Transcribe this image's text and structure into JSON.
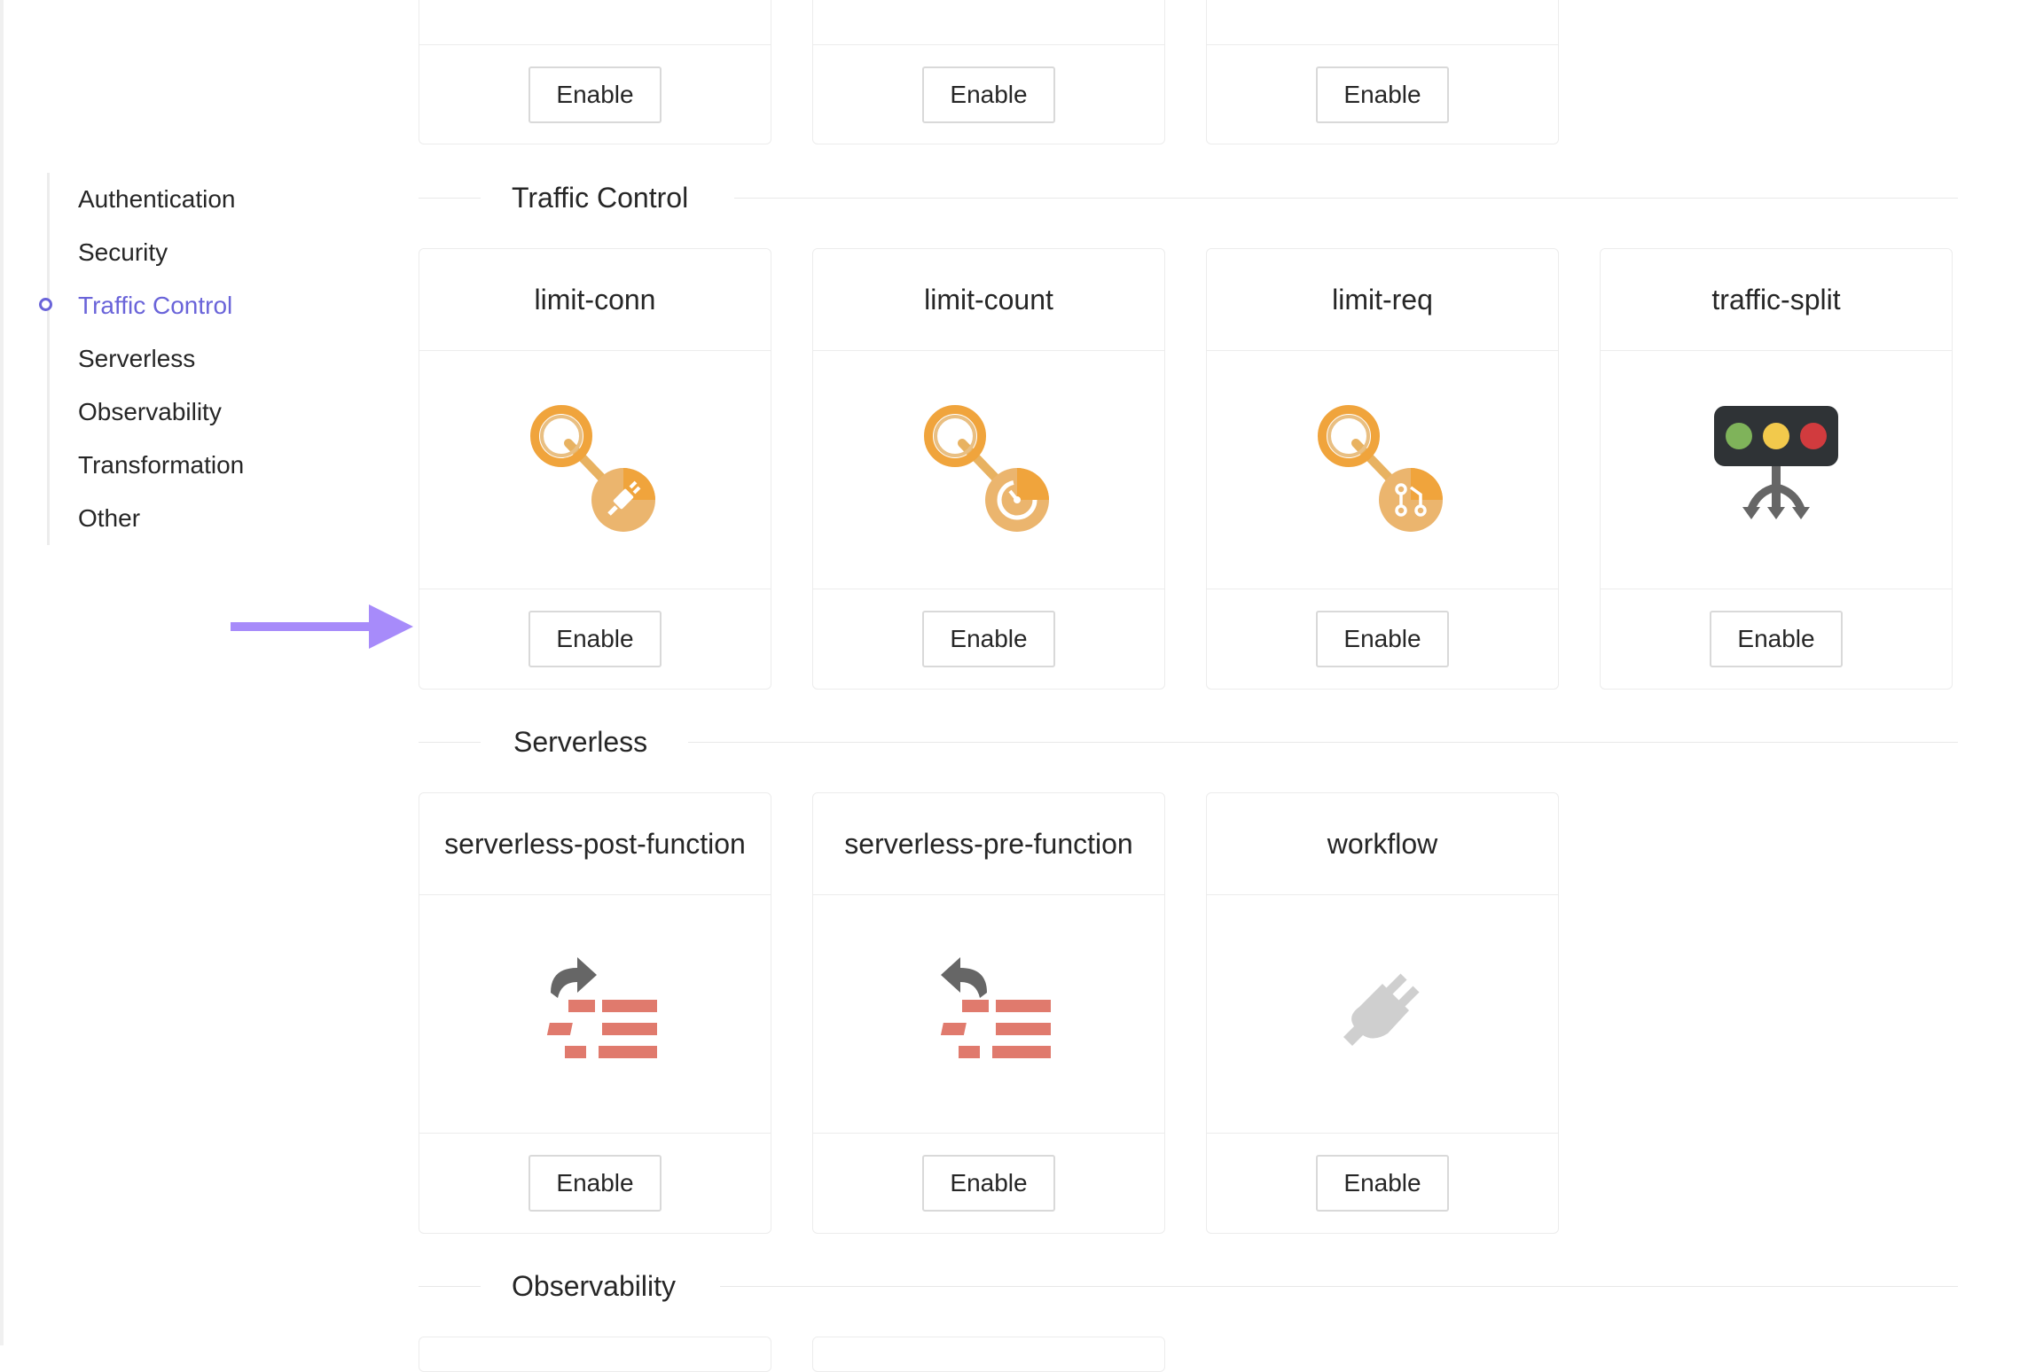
{
  "anchor": {
    "items": [
      {
        "label": "Authentication"
      },
      {
        "label": "Security"
      },
      {
        "label": "Traffic Control"
      },
      {
        "label": "Serverless"
      },
      {
        "label": "Observability"
      },
      {
        "label": "Transformation"
      },
      {
        "label": "Other"
      }
    ],
    "active": "Traffic Control",
    "accent_color": "#6a64d9"
  },
  "arrow": {
    "color": "#a78bfa"
  },
  "top_partial_cards": {
    "button_label": "Enable"
  },
  "sections": {
    "traffic_control": {
      "title": "Traffic Control",
      "cards": [
        {
          "name": "limit-conn",
          "icon": "limit-conn-icon",
          "button": "Enable"
        },
        {
          "name": "limit-count",
          "icon": "limit-count-icon",
          "button": "Enable"
        },
        {
          "name": "limit-req",
          "icon": "limit-req-icon",
          "button": "Enable"
        },
        {
          "name": "traffic-split",
          "icon": "traffic-light-icon",
          "button": "Enable"
        }
      ]
    },
    "serverless": {
      "title": "Serverless",
      "cards": [
        {
          "name": "serverless-post-function",
          "icon": "post-function-icon",
          "button": "Enable"
        },
        {
          "name": "serverless-pre-function",
          "icon": "pre-function-icon",
          "button": "Enable"
        },
        {
          "name": "workflow",
          "icon": "plug-icon",
          "button": "Enable"
        }
      ]
    },
    "observability": {
      "title": "Observability"
    }
  }
}
